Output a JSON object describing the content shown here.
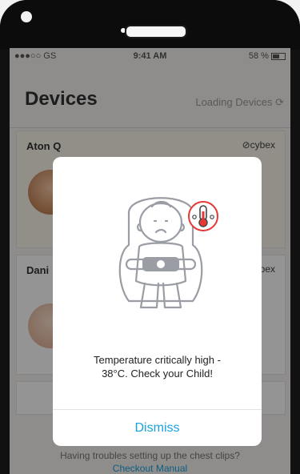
{
  "status_bar": {
    "carrier": "●●●○○ GS",
    "time": "9:41 AM",
    "battery": "58 %"
  },
  "header": {
    "title": "Devices",
    "status": "Loading Devices"
  },
  "devices": [
    {
      "name": "Aton Q",
      "brand": "cybex"
    },
    {
      "name": "Dani",
      "brand": "cybex"
    }
  ],
  "footer": {
    "question": "Having troubles setting up the chest clips?",
    "link": "Checkout Manual"
  },
  "modal": {
    "message_line1": "Temperature critically high  -",
    "message_line2": "38°C. Check your Child!",
    "dismiss": "Dismiss"
  },
  "colors": {
    "accent": "#1ba2dd",
    "alert": "#e53935"
  },
  "icons": {
    "thermometer": "thermometer-icon",
    "child_seat": "child-seat-illustration"
  }
}
